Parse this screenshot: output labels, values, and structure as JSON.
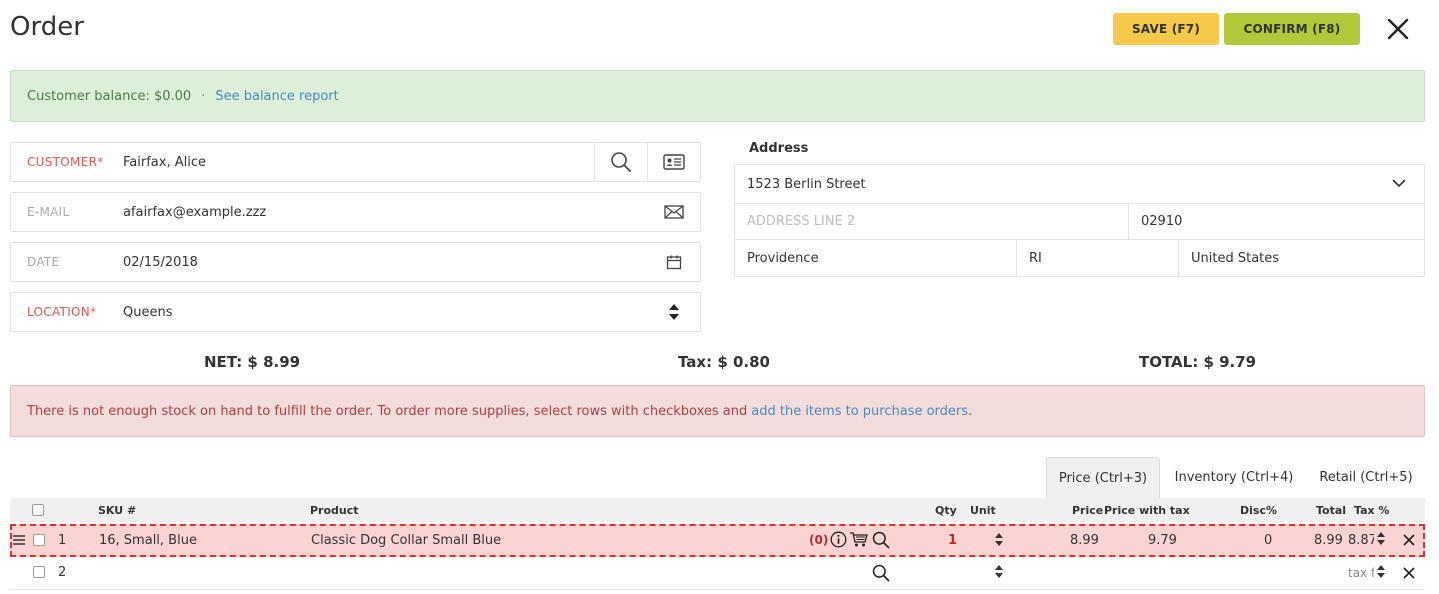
{
  "header": {
    "title": "Order",
    "save_label": "SAVE (F7)",
    "confirm_label": "CONFIRM (F8)"
  },
  "balance": {
    "text": "Customer balance: $0.00",
    "separator": "·",
    "link": "See balance report"
  },
  "form": {
    "customer": {
      "label": "CUSTOMER*",
      "value": "Fairfax, Alice"
    },
    "email": {
      "label": "E-MAIL",
      "value": "afairfax@example.zzz"
    },
    "date": {
      "label": "DATE",
      "value": "02/15/2018"
    },
    "location": {
      "label": "LOCATION*",
      "value": "Queens"
    }
  },
  "address": {
    "title": "Address",
    "line1": "1523 Berlin Street",
    "line2_placeholder": "ADDRESS LINE 2",
    "zip": "02910",
    "city": "Providence",
    "state": "RI",
    "country": "United States"
  },
  "totals": {
    "net": "NET: $ 8.99",
    "tax": "Tax: $ 0.80",
    "total": "TOTAL: $ 9.79"
  },
  "warning": {
    "text": "There is not enough stock on hand to fulfill the order. To order more supplies, select rows with checkboxes and",
    "link": "add the items to purchase orders",
    "end": "."
  },
  "tabs": [
    {
      "label": "Price (Ctrl+3)",
      "active": true
    },
    {
      "label": "Inventory (Ctrl+4)",
      "active": false
    },
    {
      "label": "Retail (Ctrl+5)",
      "active": false
    }
  ],
  "table": {
    "headers": {
      "sku": "SKU #",
      "product": "Product",
      "qty": "Qty",
      "unit": "Unit",
      "price": "Price",
      "price_with_tax": "Price with tax",
      "disc": "Disc%",
      "total": "Total",
      "tax": "Tax %"
    },
    "rows": [
      {
        "num": "1",
        "sku": "16, Small, Blue",
        "product": "Classic Dog Collar Small Blue",
        "stock": "(0)",
        "qty": "1",
        "price": "8.99",
        "price_with_tax": "9.79",
        "disc": "0",
        "total": "8.99",
        "tax": "8.87!"
      },
      {
        "num": "2",
        "tax_placeholder": "tax fr"
      }
    ]
  },
  "colors": {
    "save": "#f4c84a",
    "confirm": "#afc93a",
    "balance_bg": "#dcf0d9",
    "warning_bg": "#f2dcdc",
    "row_error": "#d9312f"
  }
}
